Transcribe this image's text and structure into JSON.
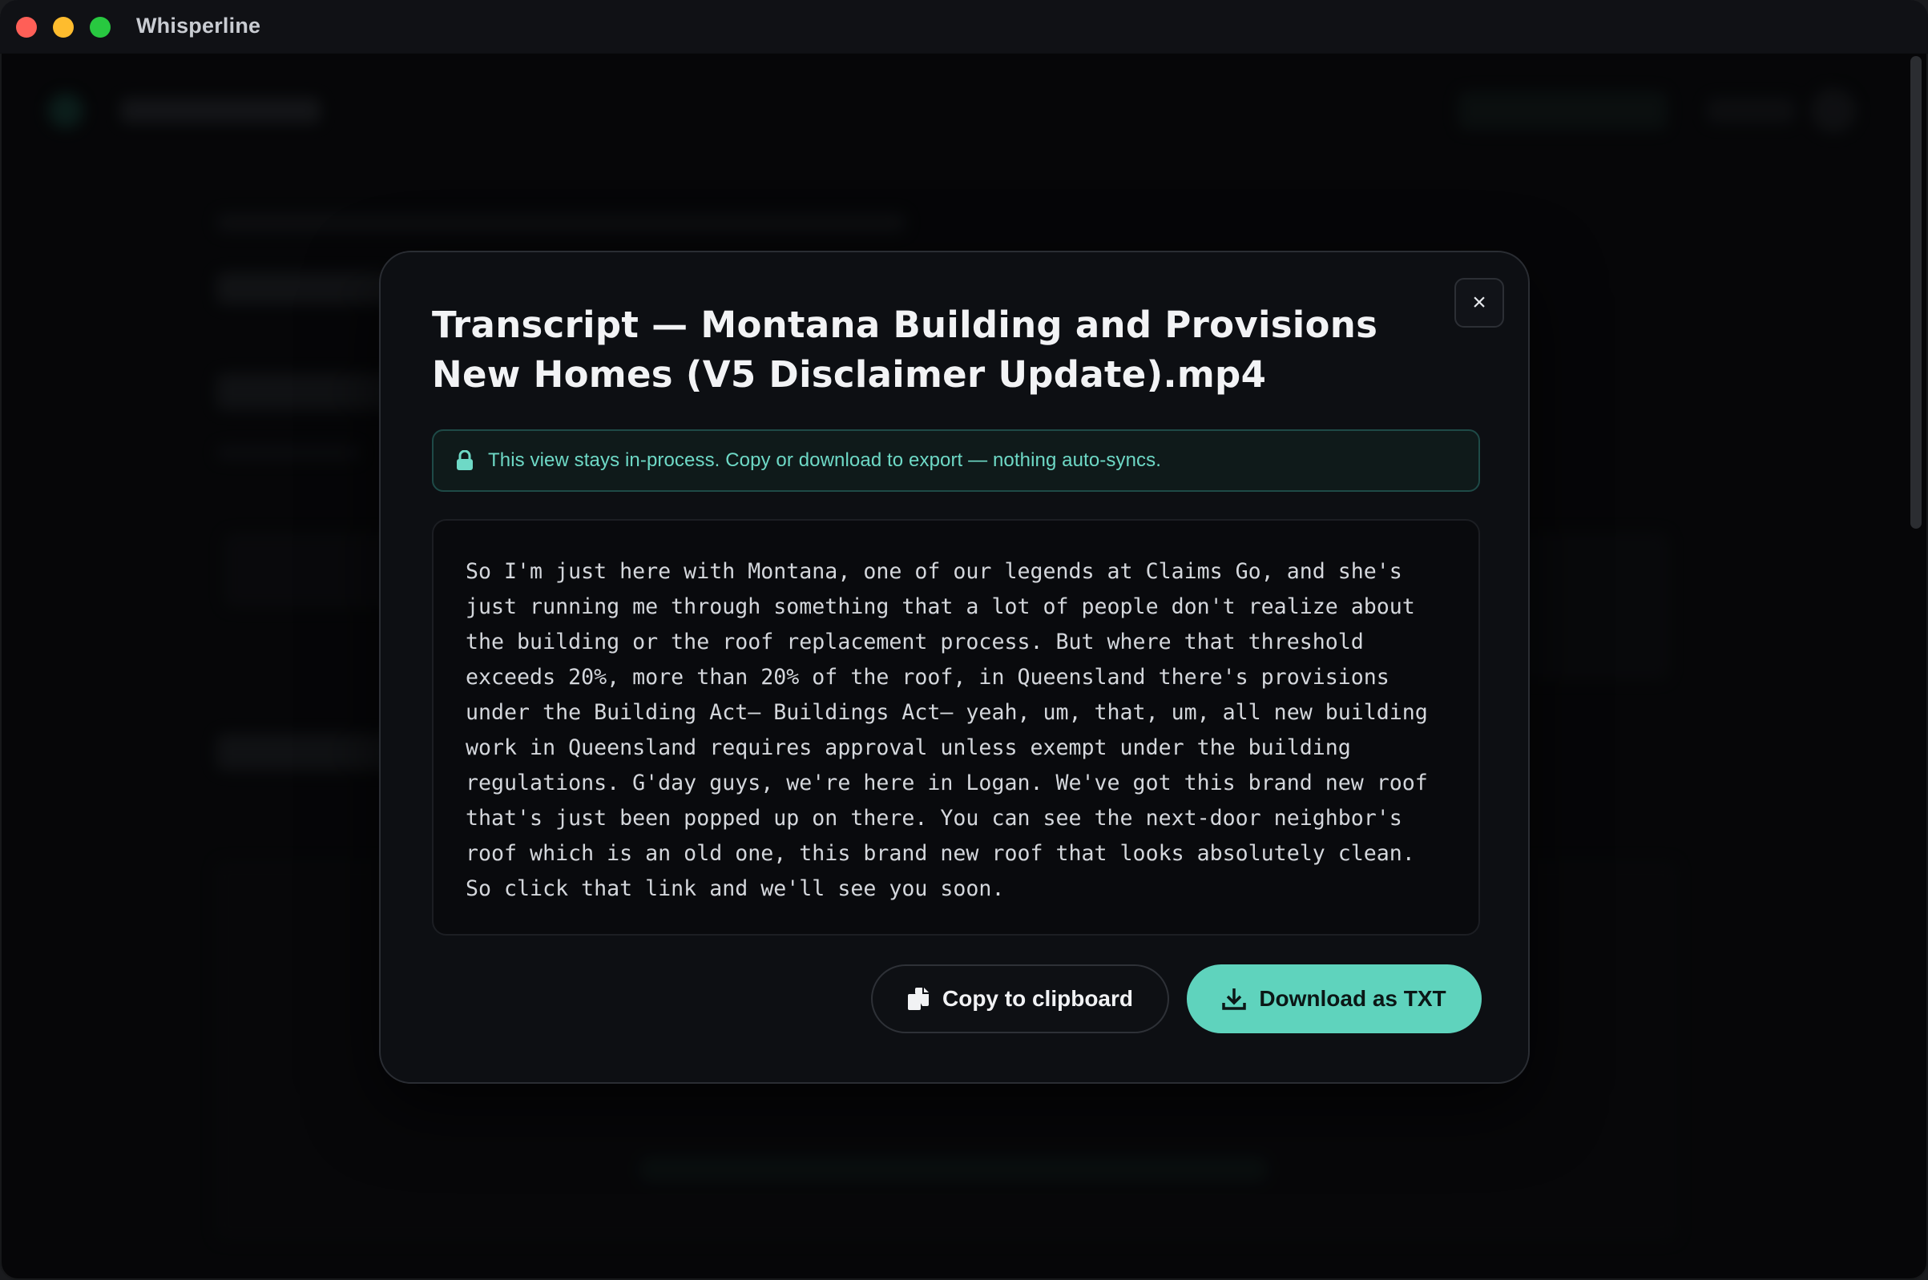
{
  "window": {
    "app_title": "Whisperline"
  },
  "modal": {
    "title": "Transcript — Montana Building and Provisions New Homes (V5 Disclaimer Update).mp4",
    "close_label": "×",
    "notice": "This view stays in-process. Copy or download to export — nothing auto-syncs.",
    "transcript": "So I'm just here with Montana, one of our legends at Claims Go, and she's just running me through something that a lot of people don't realize about the building or the roof replacement process. But where that threshold exceeds 20%, more than 20% of the roof, in Queensland there's provisions under the Building Act— Buildings Act— yeah, um, that, um, all new building work in Queensland requires approval unless exempt under the building regulations. G'day guys, we're here in Logan. We've got this brand new roof that's just been popped up on there. You can see the next-door neighbor's roof which is an old one, this brand new roof that looks absolutely clean. So click that link and we'll see you soon.",
    "copy_button": "Copy to clipboard",
    "download_button": "Download as TXT"
  },
  "colors": {
    "accent": "#5fd3bd",
    "notice_text": "#6ed9c6",
    "modal_bg": "#0d0f13"
  },
  "icons": {
    "close": "close-icon",
    "lock": "lock-icon",
    "copy": "copy-icon",
    "download": "download-icon"
  }
}
